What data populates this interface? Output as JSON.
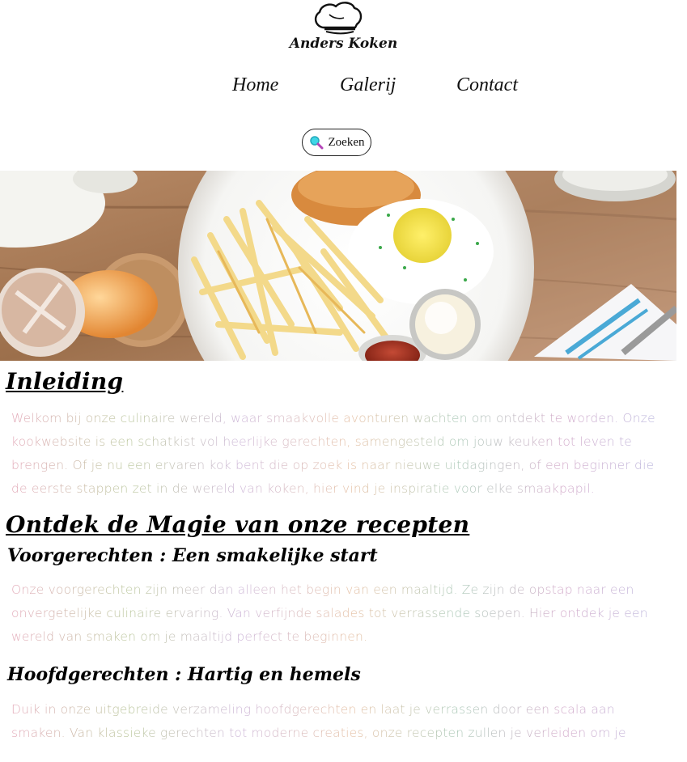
{
  "brand": {
    "name": "Anders Koken",
    "logo_icon": "chef-hat-icon"
  },
  "nav": {
    "items": [
      "Home",
      "Galerij",
      "Contact"
    ]
  },
  "search": {
    "label": "Zoeken",
    "icon": "magnifier-icon",
    "accent": "#3fd6e6"
  },
  "hero": {
    "description": "burger-fries-egg-photo"
  },
  "intro": {
    "heading": "Inleiding",
    "text": "Welkom bij onze culinaire wereld, waar smaakvolle avonturen wachten om ontdekt te worden. Onze kookwebsite is een schatkist vol heerlijke gerechten, samengesteld om jouw keuken tot leven te brengen. Of je nu een ervaren kok bent die op zoek is naar nieuwe uitdagingen, of een beginner die de eerste stappen zet in de wereld van koken, hier vind je inspiratie voor elke smaakpapil."
  },
  "recipes": {
    "heading": "Ontdek de Magie van onze recepten",
    "sections": [
      {
        "title": "Voorgerechten : Een smakelijke start",
        "text": "Onze voorgerechten zijn meer dan alleen het begin van een maaltijd. Ze zijn de opstap naar een onvergetelijke culinaire ervaring. Van verfijnde salades tot verrassende soepen. Hier ontdek je een wereld van smaken om je maaltijd perfect te beginnen."
      },
      {
        "title": "Hoofdgerechten : Hartig en hemels",
        "text": "Duik in onze uitgebreide verzameling hoofdgerechten en laat je verrassen door een scala aan smaken. Van klassieke gerechten tot moderne creaties, onze recepten zullen je verleiden om je"
      }
    ]
  }
}
